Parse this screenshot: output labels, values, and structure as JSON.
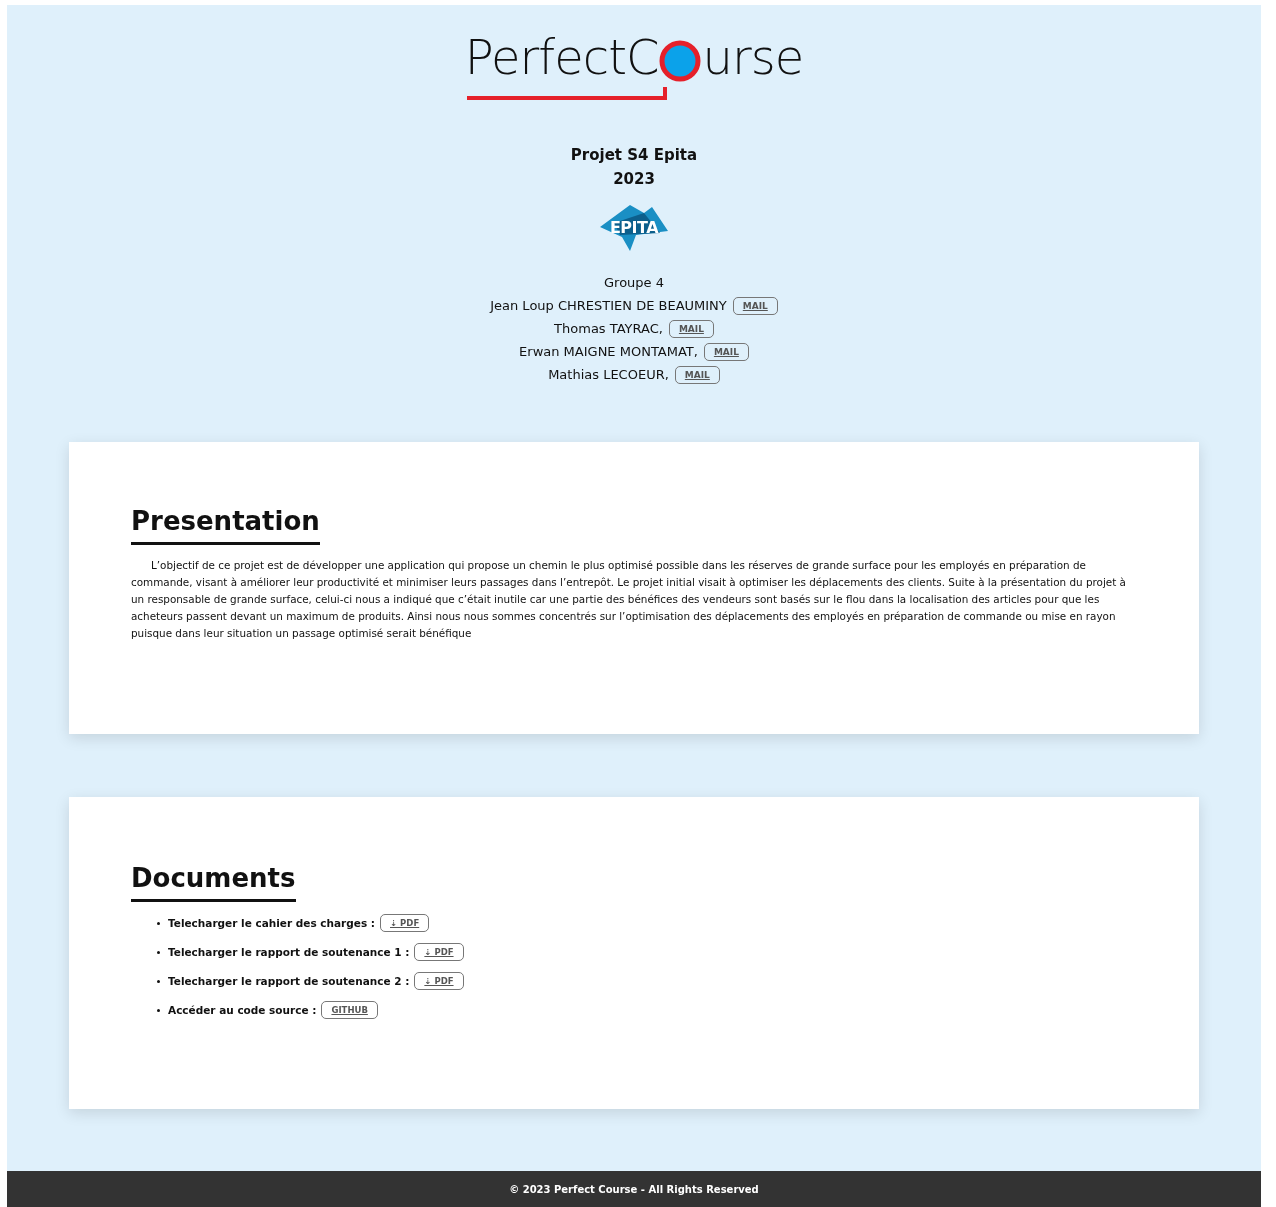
{
  "logo": {
    "text_before": "PerfectC",
    "text_after": "urse"
  },
  "header": {
    "title": "Projet S4 Epita",
    "year": "2023",
    "school_logo": "EPITA",
    "group": "Groupe 4",
    "members": [
      {
        "name": "Jean Loup CHRESTIEN DE BEAUMINY",
        "button": "MAIL"
      },
      {
        "name": "Thomas TAYRAC,",
        "button": "MAIL"
      },
      {
        "name": "Erwan MAIGNE MONTAMAT,",
        "button": "MAIL"
      },
      {
        "name": "Mathias LECOEUR,",
        "button": "MAIL"
      }
    ]
  },
  "presentation": {
    "heading": "Presentation",
    "text": "L’objectif de ce projet est de développer une application qui propose un chemin le plus optimisé possible dans les réserves de grande surface pour les employés en préparation de commande, visant à améliorer leur productivité et minimiser leurs passages dans l’entrepôt. Le projet initial visait à optimiser les déplacements des clients. Suite à la présentation du projet à un responsable de grande surface, celui-ci nous a indiqué que c’était inutile car une partie des bénéfices des vendeurs sont basés sur le flou dans la localisation des articles pour que les acheteurs passent devant un maximum de produits. Ainsi nous nous sommes concentrés sur l’optimisation des déplacements des employés en préparation de commande ou mise en rayon puisque dans leur situation un passage optimisé serait bénéfique"
  },
  "documents": {
    "heading": "Documents",
    "items": [
      {
        "label": "Telecharger le cahier des charges :",
        "button": "⇣ PDF"
      },
      {
        "label": "Telecharger le rapport de soutenance 1 :",
        "button": "⇣ PDF"
      },
      {
        "label": "Telecharger le rapport de soutenance 2 :",
        "button": "⇣ PDF"
      },
      {
        "label": "Accéder au code source :",
        "button": "GITHUB"
      }
    ]
  },
  "footer": {
    "text": "© 2023 Perfect Course - All Rights Reserved"
  }
}
